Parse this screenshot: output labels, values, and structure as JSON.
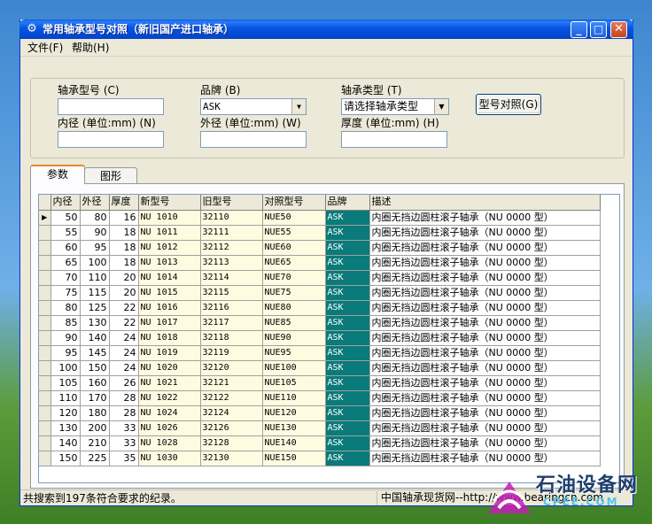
{
  "window": {
    "title": "常用轴承型号对照（新旧国产进口轴承）"
  },
  "menu": {
    "file": "文件(F)",
    "help": "帮助(H)"
  },
  "form": {
    "bearing_model_label": "轴承型号",
    "bearing_model_key": "(C)",
    "brand_label": "品牌",
    "brand_key": "(B)",
    "brand_value": "ASK",
    "bearing_type_label": "轴承类型",
    "bearing_type_key": "(T)",
    "bearing_type_value": "请选择轴承类型",
    "inner_diameter_label": "内径 (单位:mm)",
    "inner_diameter_key": "(N)",
    "outer_diameter_label": "外径 (单位:mm)",
    "outer_diameter_key": "(W)",
    "thickness_label": "厚度 (单位:mm)",
    "thickness_key": "(H)",
    "query_button": "型号对照(G)"
  },
  "tabs": {
    "params": "参数",
    "graph": "图形"
  },
  "table": {
    "columns": [
      "内径",
      "外径",
      "厚度",
      "新型号",
      "旧型号",
      "对照型号",
      "品牌",
      "描述"
    ],
    "rows": [
      [
        "50",
        "80",
        "16",
        "NU 1010",
        "32110",
        "NUE50",
        "ASK",
        "内圈无挡边圆柱滚子轴承（NU 0000 型）"
      ],
      [
        "55",
        "90",
        "18",
        "NU 1011",
        "32111",
        "NUE55",
        "ASK",
        "内圈无挡边圆柱滚子轴承（NU 0000 型）"
      ],
      [
        "60",
        "95",
        "18",
        "NU 1012",
        "32112",
        "NUE60",
        "ASK",
        "内圈无挡边圆柱滚子轴承（NU 0000 型）"
      ],
      [
        "65",
        "100",
        "18",
        "NU 1013",
        "32113",
        "NUE65",
        "ASK",
        "内圈无挡边圆柱滚子轴承（NU 0000 型）"
      ],
      [
        "70",
        "110",
        "20",
        "NU 1014",
        "32114",
        "NUE70",
        "ASK",
        "内圈无挡边圆柱滚子轴承（NU 0000 型）"
      ],
      [
        "75",
        "115",
        "20",
        "NU 1015",
        "32115",
        "NUE75",
        "ASK",
        "内圈无挡边圆柱滚子轴承（NU 0000 型）"
      ],
      [
        "80",
        "125",
        "22",
        "NU 1016",
        "32116",
        "NUE80",
        "ASK",
        "内圈无挡边圆柱滚子轴承（NU 0000 型）"
      ],
      [
        "85",
        "130",
        "22",
        "NU 1017",
        "32117",
        "NUE85",
        "ASK",
        "内圈无挡边圆柱滚子轴承（NU 0000 型）"
      ],
      [
        "90",
        "140",
        "24",
        "NU 1018",
        "32118",
        "NUE90",
        "ASK",
        "内圈无挡边圆柱滚子轴承（NU 0000 型）"
      ],
      [
        "95",
        "145",
        "24",
        "NU 1019",
        "32119",
        "NUE95",
        "ASK",
        "内圈无挡边圆柱滚子轴承（NU 0000 型）"
      ],
      [
        "100",
        "150",
        "24",
        "NU 1020",
        "32120",
        "NUE100",
        "ASK",
        "内圈无挡边圆柱滚子轴承（NU 0000 型）"
      ],
      [
        "105",
        "160",
        "26",
        "NU 1021",
        "32121",
        "NUE105",
        "ASK",
        "内圈无挡边圆柱滚子轴承（NU 0000 型）"
      ],
      [
        "110",
        "170",
        "28",
        "NU 1022",
        "32122",
        "NUE110",
        "ASK",
        "内圈无挡边圆柱滚子轴承（NU 0000 型）"
      ],
      [
        "120",
        "180",
        "28",
        "NU 1024",
        "32124",
        "NUE120",
        "ASK",
        "内圈无挡边圆柱滚子轴承（NU 0000 型）"
      ],
      [
        "130",
        "200",
        "33",
        "NU 1026",
        "32126",
        "NUE130",
        "ASK",
        "内圈无挡边圆柱滚子轴承（NU 0000 型）"
      ],
      [
        "140",
        "210",
        "33",
        "NU 1028",
        "32128",
        "NUE140",
        "ASK",
        "内圈无挡边圆柱滚子轴承（NU 0000 型）"
      ],
      [
        "150",
        "225",
        "35",
        "NU 1030",
        "32130",
        "NUE150",
        "ASK",
        "内圈无挡边圆柱滚子轴承（NU 0000 型）"
      ]
    ]
  },
  "status": {
    "left": "共搜索到197条符合要求的纪录。",
    "right": "中国轴承现货网--http://www.bearingcn.com"
  },
  "watermark": {
    "text": "石油设备网",
    "sub": "CPEE.COM"
  },
  "colors": {
    "brand_cell": "#0a7a7a",
    "model_cell": "#fffbe0",
    "titlebar": "#0554e3"
  }
}
